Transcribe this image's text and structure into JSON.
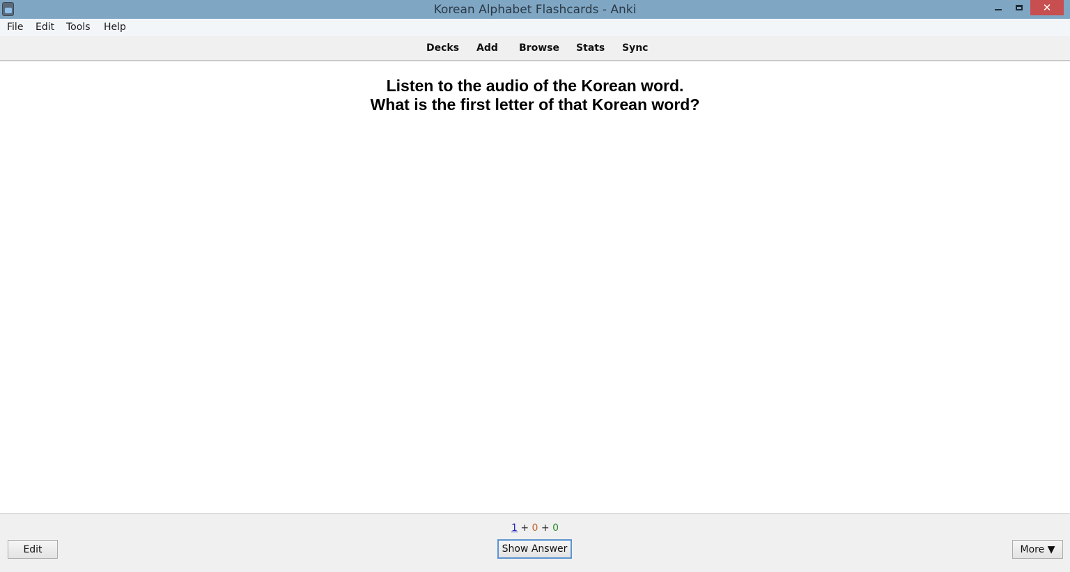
{
  "window": {
    "title": "Korean Alphabet Flashcards - Anki",
    "controls": {
      "minimize": "minimize",
      "maximize": "restore",
      "close": "✕"
    }
  },
  "menubar": {
    "items": [
      {
        "label": "File"
      },
      {
        "label": "Edit"
      },
      {
        "label": "Tools"
      },
      {
        "label": "Help"
      }
    ]
  },
  "toolbar": {
    "links": [
      {
        "label": "Decks"
      },
      {
        "label": "Add"
      },
      {
        "label": "Browse"
      },
      {
        "label": "Stats"
      },
      {
        "label": "Sync"
      }
    ]
  },
  "card": {
    "question_line1": "Listen to the audio of the Korean word.",
    "question_line2": "What is the first letter of that Korean word?"
  },
  "bottombar": {
    "counts": {
      "new": "1",
      "learning": "0",
      "review": "0",
      "separator": " + "
    },
    "edit_label": "Edit",
    "show_answer_label": "Show Answer",
    "more_label": "More ▼"
  },
  "colors": {
    "titlebar": "#7fa7c4",
    "close": "#c74f4f",
    "new_count": "#2a2ab8",
    "learning_count": "#c0622a",
    "review_count": "#2a8a2a",
    "focus_border": "#5b95d0"
  }
}
